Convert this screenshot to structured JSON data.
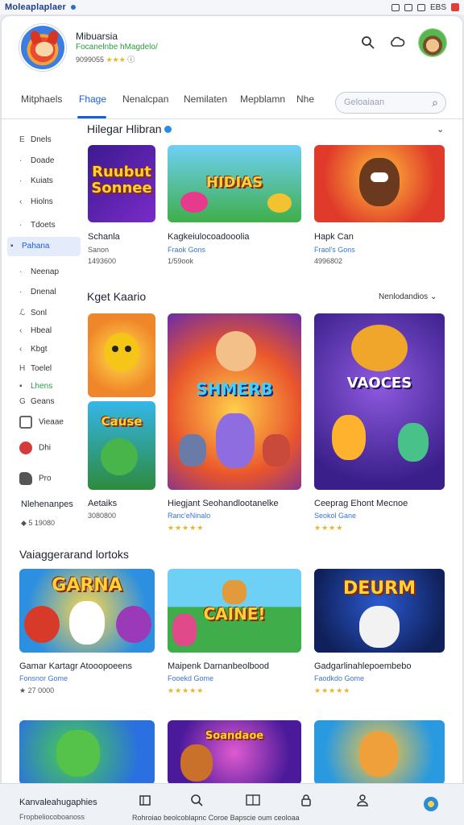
{
  "status_bar": {
    "app_title": "Moleaplaplaer",
    "right_text": "EBS"
  },
  "profile": {
    "name": "Mibuarsia",
    "subtitle": "Focanelnbe hMagdelo/",
    "meta": "9099055",
    "stars": "★★★"
  },
  "header_icons": [
    "search-icon",
    "cloud-icon"
  ],
  "tabs": {
    "items": [
      {
        "label": "Mitphaels"
      },
      {
        "label": "Fhage"
      },
      {
        "label": "Nenalcpan"
      },
      {
        "label": "Nemilaten"
      },
      {
        "label": "Mepblamn"
      },
      {
        "label": "Nhe"
      }
    ],
    "active_index": 1,
    "search_placeholder": "Geloaiaan"
  },
  "sidebar": {
    "items": [
      {
        "icon": "E",
        "label": "Dnels"
      },
      {
        "icon": "·",
        "label": "Doade"
      },
      {
        "icon": "·",
        "label": "Kuiats"
      },
      {
        "icon": "‹",
        "label": "Hiolns"
      },
      {
        "icon": "·",
        "label": "Tdoets"
      },
      {
        "icon": "▪",
        "label": "Pahana"
      },
      {
        "icon": "·",
        "label": "Neenap"
      },
      {
        "icon": "·",
        "label": "Dnenal"
      },
      {
        "icon": "ℒ",
        "label": "Sonl"
      },
      {
        "icon": "‹",
        "label": "Hbeal"
      },
      {
        "icon": "‹",
        "label": "Kbgt"
      },
      {
        "icon": "H",
        "label": "Toelel"
      },
      {
        "icon": "▪",
        "label": "Lhens"
      },
      {
        "icon": "G",
        "label": "Geans"
      },
      {
        "icon": "",
        "label": "Vieaae"
      },
      {
        "icon": "",
        "label": "Dhi"
      },
      {
        "icon": "",
        "label": "Pro"
      }
    ],
    "active_index": 5,
    "footer_title": "Nlehenanpes",
    "footer_meta": "◆ 5 19080"
  },
  "sections": [
    {
      "title": "Hilegar Hlibran",
      "cards": [
        {
          "image_text": "Ruubut Sonnee",
          "title": "Schanla",
          "sub": "Sanon",
          "meta": "1493600"
        },
        {
          "image_text": "HIDIAS",
          "title": "Kagkeiulocoadooolia",
          "sub": "Fraok Gons",
          "meta": "1/59ook"
        },
        {
          "image_text": "",
          "title": "Hapk Can",
          "sub": "Fraol's Gons",
          "meta": "4996802"
        }
      ]
    },
    {
      "title": "Kget Kaario",
      "more": "Nenlodandios",
      "cards": [
        {
          "image_text": "Cause",
          "title": "Aetaiks",
          "sub": "",
          "meta": "3080800"
        },
        {
          "image_text": "SHMERB",
          "title": "Hiegjant Seohandlootanelke",
          "sub": "Ranc'eNinalo",
          "stars": "★★★★★"
        },
        {
          "image_text": "VAOCES",
          "title": "Ceeprag Ehont Mecnoe",
          "sub": "Seokol Gane",
          "stars": "★★★★"
        }
      ]
    },
    {
      "title": "Vaiaggerarand lortoks",
      "cards": [
        {
          "image_text": "GARNA",
          "title": "Gamar Kartagr Atooopoeens",
          "sub": "Fonsnor Gome",
          "meta": "★ 27 0000"
        },
        {
          "image_text": "CAINE!",
          "title": "Maipenk Darnanbeolbood",
          "sub": "Fooekd Gome",
          "stars": "★★★★★"
        },
        {
          "image_text": "DEURM",
          "title": "Gadgarlinahlepoembebo",
          "sub": "Faodkdo Gome",
          "stars": "★★★★★"
        }
      ]
    }
  ],
  "row4_images": [
    "",
    "Soandaoe",
    ""
  ],
  "bottom_bar": {
    "title": "Kanvaleahugaphies",
    "sub": "Fropbeliocoboanoss",
    "labels": "Rohroiao beolcoblapnc Coroe Bapscie oum ceoloaa",
    "icons": [
      "store-icon",
      "search-icon",
      "library-icon",
      "lock-icon",
      "person-icon"
    ]
  },
  "colors": {
    "accent": "#1a5fd0",
    "star": "#e9b526",
    "green": "#2a9c3f"
  }
}
